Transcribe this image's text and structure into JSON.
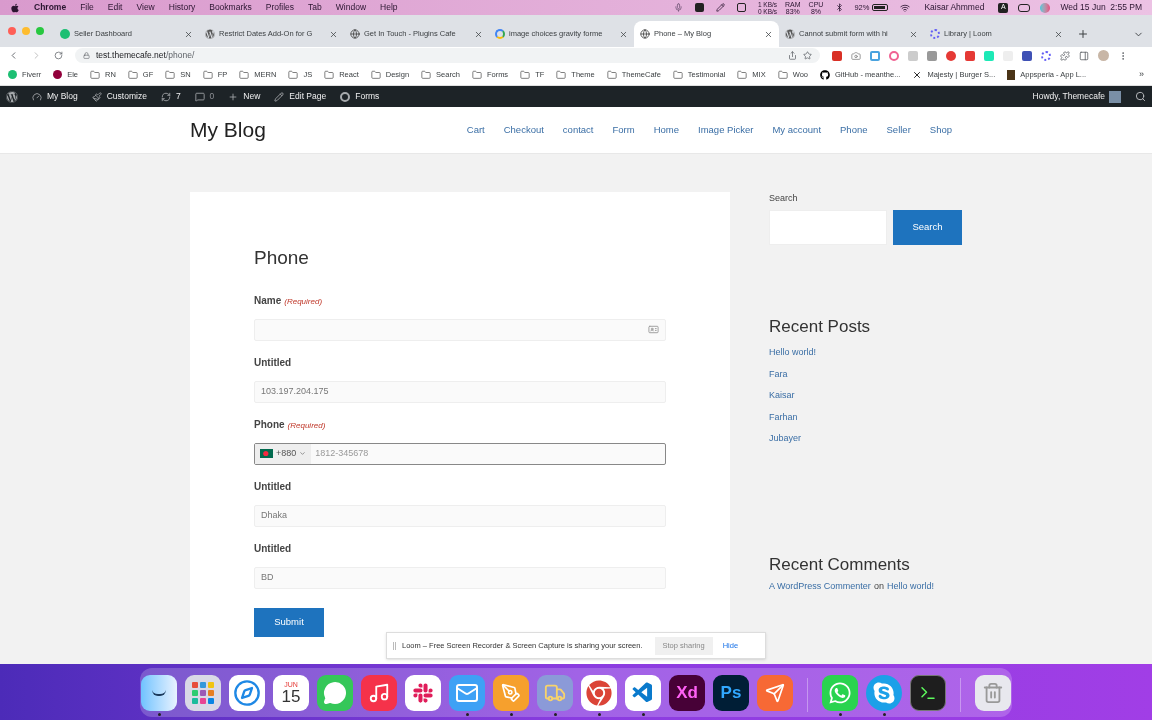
{
  "menubar": {
    "app": "Chrome",
    "menus": [
      "File",
      "Edit",
      "View",
      "History",
      "Bookmarks",
      "Profiles",
      "Tab",
      "Window",
      "Help"
    ],
    "status": {
      "net_up": "1 KB/s",
      "net_down": "0 KB/s",
      "ram_label": "RAM",
      "ram": "83%",
      "cpu_label": "CPU",
      "cpu": "8%",
      "battery": "92%",
      "user": "Kaisar Ahmmed",
      "user_badge": "A",
      "datetime": "Wed 15 Jun  2:55 PM"
    }
  },
  "tabs": [
    {
      "title": "Seller Dashboard",
      "kind": "seller",
      "selected": false
    },
    {
      "title": "Restrict Dates Add-On for G",
      "kind": "wordpress",
      "selected": false
    },
    {
      "title": "Get In Touch - Plugins Cafe",
      "kind": "globe",
      "selected": false
    },
    {
      "title": "image choices gravity forme",
      "kind": "google",
      "selected": false
    },
    {
      "title": "Phone – My Blog",
      "kind": "globe",
      "selected": true
    },
    {
      "title": "Cannot submit form with hi",
      "kind": "wordpress",
      "selected": false
    },
    {
      "title": "Library | Loom",
      "kind": "loom",
      "selected": false
    }
  ],
  "address": {
    "host": "test.themecafe.net",
    "path": "/phone/"
  },
  "bookmarks": [
    {
      "label": "Fiverr",
      "kind": "fiverr"
    },
    {
      "label": "Ele",
      "kind": "elementor"
    },
    {
      "label": "RN",
      "kind": "folder"
    },
    {
      "label": "GF",
      "kind": "folder"
    },
    {
      "label": "SN",
      "kind": "folder"
    },
    {
      "label": "FP",
      "kind": "folder"
    },
    {
      "label": "MERN",
      "kind": "folder"
    },
    {
      "label": "JS",
      "kind": "folder"
    },
    {
      "label": "React",
      "kind": "folder"
    },
    {
      "label": "Design",
      "kind": "folder"
    },
    {
      "label": "Search",
      "kind": "folder"
    },
    {
      "label": "Forms",
      "kind": "folder"
    },
    {
      "label": "TF",
      "kind": "folder"
    },
    {
      "label": "Theme",
      "kind": "folder"
    },
    {
      "label": "ThemeCafe",
      "kind": "folder"
    },
    {
      "label": "Testimonial",
      "kind": "folder"
    },
    {
      "label": "MIX",
      "kind": "folder"
    },
    {
      "label": "Woo",
      "kind": "folder"
    },
    {
      "label": "GitHub - meanthe...",
      "kind": "github"
    },
    {
      "label": "Majesty | Burger S...",
      "kind": "cross"
    },
    {
      "label": "Appsperia - App L...",
      "kind": "app"
    }
  ],
  "bookmarks_more": "»",
  "admin_bar": {
    "items": [
      {
        "label": "My Blog",
        "kind": "dashboard"
      },
      {
        "label": "Customize",
        "kind": "brush"
      },
      {
        "label": "7",
        "kind": "updates"
      },
      {
        "label": "0",
        "kind": "comments"
      },
      {
        "label": "New",
        "kind": "plus"
      },
      {
        "label": "Edit Page",
        "kind": "pencil"
      },
      {
        "label": "Forms",
        "kind": "forms"
      }
    ],
    "greeting": "Howdy, Themecafe"
  },
  "site": {
    "title": "My Blog",
    "nav": [
      "Cart",
      "Checkout",
      "contact",
      "Form",
      "Home",
      "Image Picker",
      "My account",
      "Phone",
      "Seller",
      "Shop"
    ]
  },
  "form": {
    "title": "Phone",
    "fields": [
      {
        "kind": "text",
        "label": "Name",
        "required": "(Required)",
        "focused": false
      },
      {
        "kind": "text",
        "label": "Untitled",
        "value": "103.197.204.175",
        "focused": false
      },
      {
        "kind": "phone",
        "label": "Phone",
        "required": "(Required)",
        "dial_code": "+880",
        "placeholder": "1812-345678",
        "focused": true
      },
      {
        "kind": "text",
        "label": "Untitled",
        "value": "Dhaka",
        "focused": false
      },
      {
        "kind": "text",
        "label": "Untitled",
        "value": "BD",
        "focused": false
      }
    ],
    "submit": "Submit"
  },
  "sidebar": {
    "search_label": "Search",
    "search_button": "Search",
    "recent_posts_title": "Recent Posts",
    "recent_posts": [
      "Hello world!",
      "Fara",
      "Kaisar",
      "Farhan",
      "Jubayer"
    ],
    "recent_comments_title": "Recent Comments",
    "comment": {
      "author": "A WordPress Commenter",
      "joiner": "on",
      "post": "Hello world!"
    }
  },
  "loom_bar": {
    "message": "Loom – Free Screen Recorder & Screen Capture is sharing your screen.",
    "stop": "Stop sharing",
    "hide": "Hide"
  },
  "dock": [
    {
      "kind": "finder",
      "running": true
    },
    {
      "kind": "launchpad",
      "running": false
    },
    {
      "kind": "safari",
      "running": false
    },
    {
      "kind": "calendar",
      "month": "JUN",
      "day": "15",
      "running": false
    },
    {
      "kind": "messages",
      "running": false
    },
    {
      "kind": "music",
      "running": false
    },
    {
      "kind": "slack",
      "running": false
    },
    {
      "kind": "mail",
      "running": true
    },
    {
      "kind": "pages",
      "running": true
    },
    {
      "kind": "transmit",
      "running": true
    },
    {
      "kind": "chrome",
      "running": true
    },
    {
      "kind": "vscode",
      "running": true
    },
    {
      "kind": "xd",
      "label": "Xd",
      "running": false
    },
    {
      "kind": "ps",
      "label": "Ps",
      "running": false
    },
    {
      "kind": "postman",
      "running": false
    },
    {
      "kind": "separator"
    },
    {
      "kind": "whatsapp",
      "running": true
    },
    {
      "kind": "skype",
      "running": true
    },
    {
      "kind": "terminal",
      "running": false
    },
    {
      "kind": "separator"
    },
    {
      "kind": "trash",
      "running": false
    }
  ]
}
